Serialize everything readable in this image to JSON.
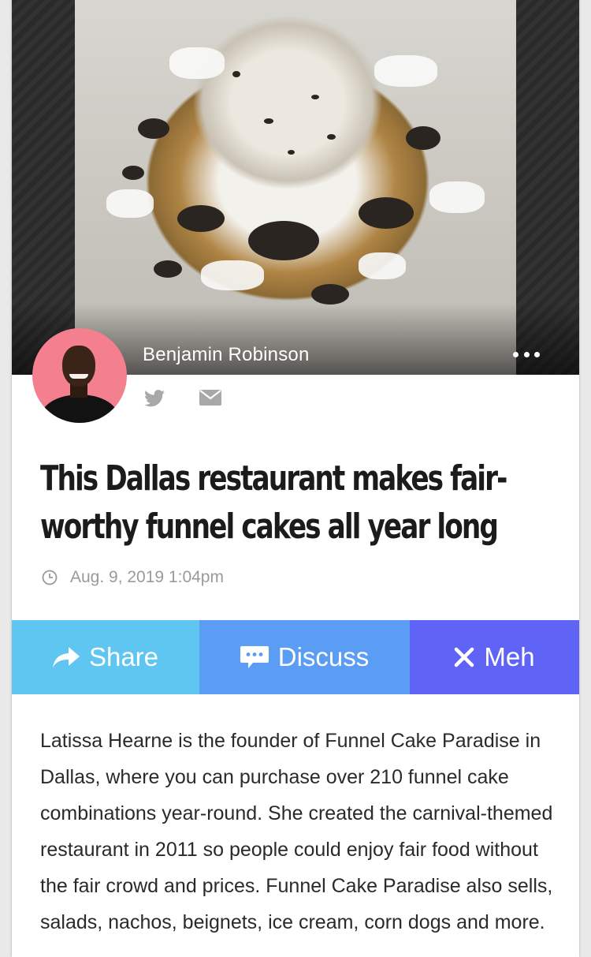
{
  "post": {
    "author_name": "Benjamin Robinson",
    "title": "This Dallas restaurant makes fair-worthy funnel cakes all year long",
    "timestamp": "Aug. 9, 2019 1:04pm",
    "body": "Latissa Hearne is the founder of Funnel Cake Paradise in Dallas, where you can purchase over 210 funnel cake combinations year-round. She created the carnival-themed restaurant in 2011 so people could enjoy fair food without the fair crowd and prices. Funnel Cake Paradise also sells, salads, nachos, beignets, ice cream, corn dogs and more."
  },
  "actions": [
    {
      "label": "Share",
      "icon": "share-arrow-icon",
      "color": "#5fc6f2"
    },
    {
      "label": "Discuss",
      "icon": "chat-bubble-icon",
      "color": "#5b9df5"
    },
    {
      "label": "Meh",
      "icon": "close-x-icon",
      "color": "#5f63f6"
    }
  ],
  "icons": {
    "more": "more-dots-icon",
    "twitter": "twitter-icon",
    "email": "email-icon",
    "clock": "clock-icon"
  },
  "colors": {
    "background": "#e9e9e9",
    "card": "#ffffff",
    "avatar_bg": "#f47f8e",
    "meta_text": "#9a9a9a",
    "social_icon": "#a8a8a8"
  }
}
